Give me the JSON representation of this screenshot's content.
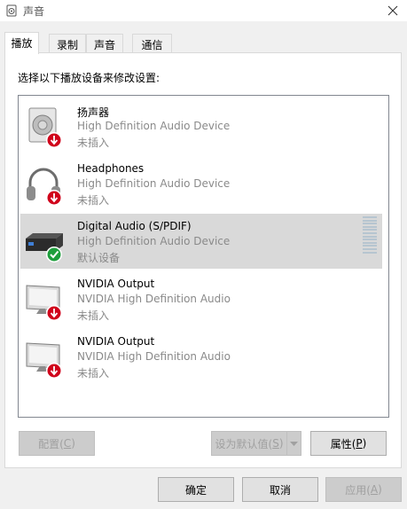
{
  "window": {
    "title": "声音",
    "icons": {
      "app": "speaker-app-icon",
      "close": "close-icon"
    }
  },
  "tabs": [
    {
      "label": "播放",
      "active": true
    },
    {
      "label": "录制",
      "active": false
    },
    {
      "label": "声音",
      "active": false
    },
    {
      "label": "通信",
      "active": false
    }
  ],
  "instruction": "选择以下播放设备来修改设置:",
  "devices": [
    {
      "name": "扬声器",
      "description": "High Definition Audio Device",
      "status": "未插入",
      "icon": "speaker-icon",
      "badge": "unplugged-badge"
    },
    {
      "name": "Headphones",
      "description": "High Definition Audio Device",
      "status": "未插入",
      "icon": "headphones-icon",
      "badge": "unplugged-badge"
    },
    {
      "name": "Digital Audio (S/PDIF)",
      "description": "High Definition Audio Device",
      "status": "默认设备",
      "icon": "digital-audio-icon",
      "badge": "default-check-badge",
      "selected": true
    },
    {
      "name": "NVIDIA Output",
      "description": "NVIDIA High Definition Audio",
      "status": "未插入",
      "icon": "monitor-icon",
      "badge": "unplugged-badge"
    },
    {
      "name": "NVIDIA Output",
      "description": "NVIDIA High Definition Audio",
      "status": "未插入",
      "icon": "monitor-icon",
      "badge": "unplugged-badge"
    }
  ],
  "buttons": {
    "configure": {
      "label": "配置(",
      "key": "C",
      "tail": ")"
    },
    "set_default": {
      "label": "设为默认值(",
      "key": "S",
      "tail": ")"
    },
    "properties": {
      "label": "属性(",
      "key": "P",
      "tail": ")"
    },
    "ok": {
      "label": "确定"
    },
    "cancel": {
      "label": "取消"
    },
    "apply": {
      "label": "应用(",
      "key": "A",
      "tail": ")"
    }
  },
  "colors": {
    "selection": "#d9d9d9",
    "unplugged_badge": "#d0021b",
    "default_badge": "#1e9e3c",
    "meter": "#b6c5d0"
  }
}
